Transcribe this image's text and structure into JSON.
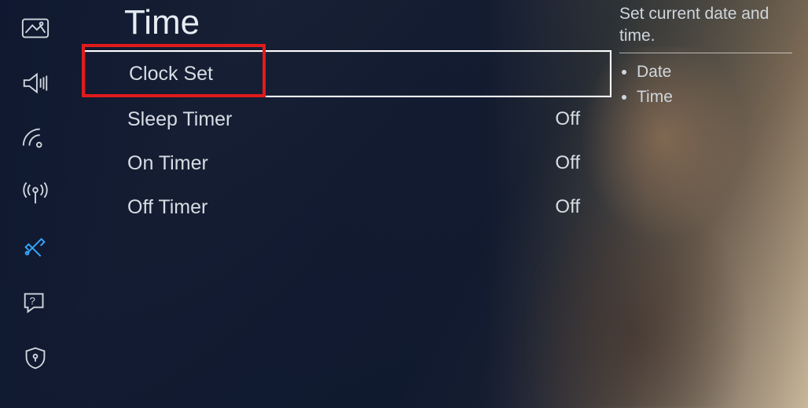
{
  "page_title": "Time",
  "rows": [
    {
      "label": "Clock Set",
      "value": "",
      "selected": true
    },
    {
      "label": "Sleep Timer",
      "value": "Off",
      "selected": false
    },
    {
      "label": "On Timer",
      "value": "Off",
      "selected": false
    },
    {
      "label": "Off Timer",
      "value": "Off",
      "selected": false
    }
  ],
  "help": {
    "text": "Set current date and time.",
    "bullets": [
      "Date",
      "Time"
    ]
  },
  "sidebar_icons": [
    "picture-icon",
    "sound-icon",
    "broadcast-icon",
    "antenna-icon",
    "system-icon",
    "support-icon",
    "security-icon"
  ],
  "active_sidebar_index": 4
}
